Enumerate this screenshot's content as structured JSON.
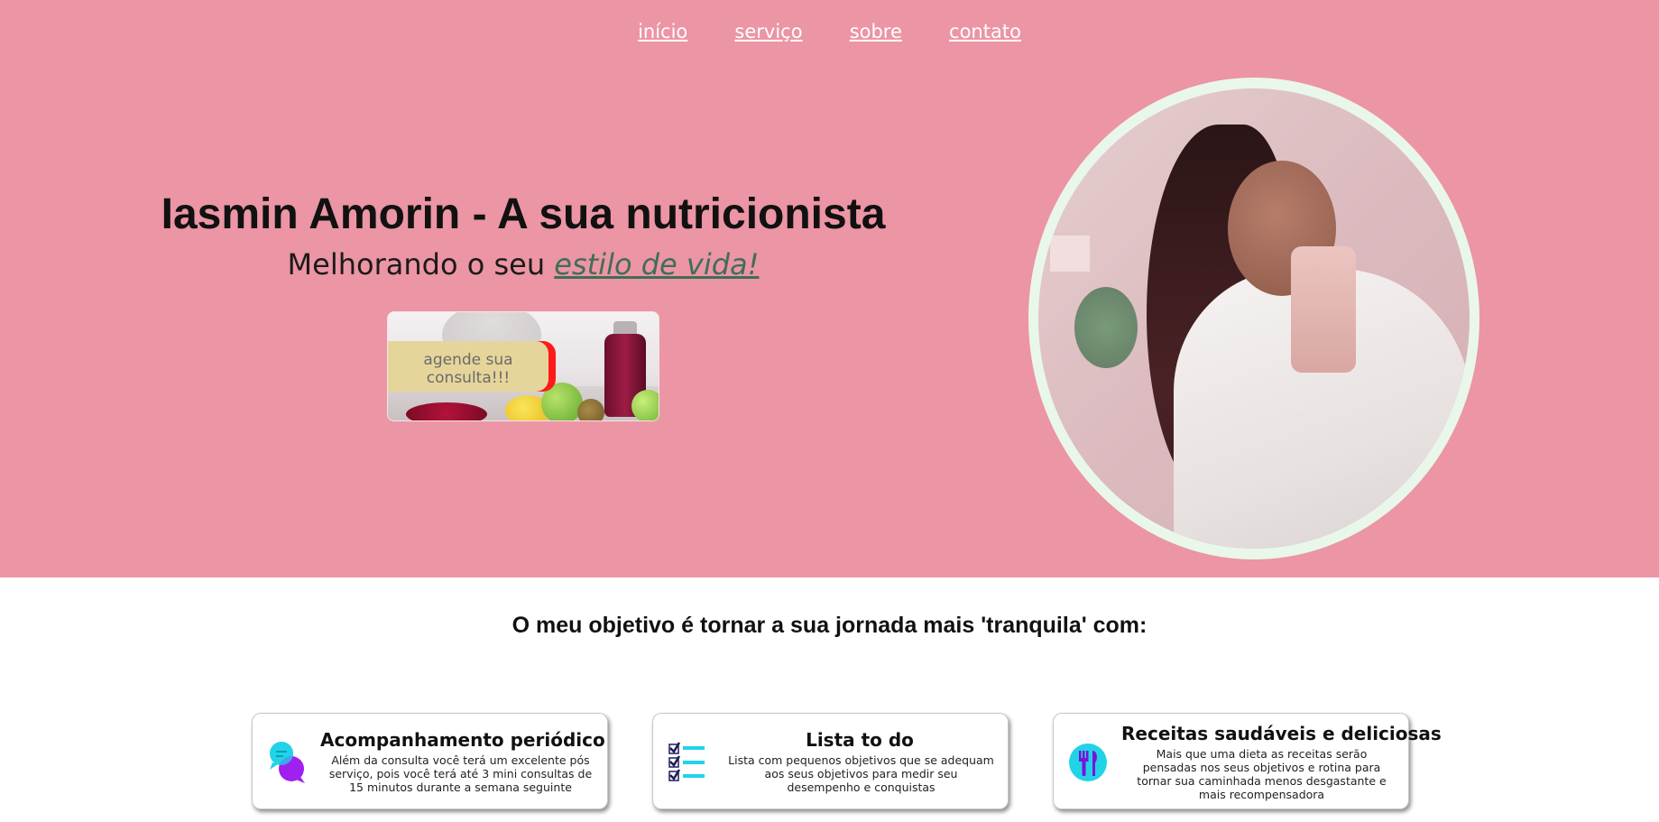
{
  "nav": {
    "items": [
      {
        "label": "início"
      },
      {
        "label": "serviço"
      },
      {
        "label": "sobre"
      },
      {
        "label": "contato"
      }
    ]
  },
  "hero": {
    "title": "Iasmin Amorin - A sua nutricionista",
    "subtitle_prefix": "Melhorando o seu ",
    "subtitle_accent": "estilo de vida!",
    "cta_label": "agende sua consulta!!!",
    "colors": {
      "background": "#ec95a4",
      "accent_text": "#3f6e57",
      "cta_button": "#e6d59a",
      "ring": "#e9f7ea"
    }
  },
  "goal": {
    "title": "O meu objetivo é tornar a sua jornada mais 'tranquila' com:"
  },
  "cards": [
    {
      "icon": "chat-bubbles-icon",
      "title": "Acompanhamento periódico",
      "text": "Além da consulta você terá um excelente pós serviço, pois você terá até 3 mini consultas de 15 minutos durante a semana seguinte"
    },
    {
      "icon": "checklist-icon",
      "title": "Lista to do",
      "text": "Lista com pequenos objetivos que se adequam aos seus objetivos para medir seu desempenho e conquistas"
    },
    {
      "icon": "cutlery-icon",
      "title": "Receitas saudáveis e deliciosas",
      "text": "Mais que uma dieta as receitas serão pensadas nos seus objetivos e rotina para tornar sua caminhada menos desgastante e mais recompensadora"
    }
  ]
}
